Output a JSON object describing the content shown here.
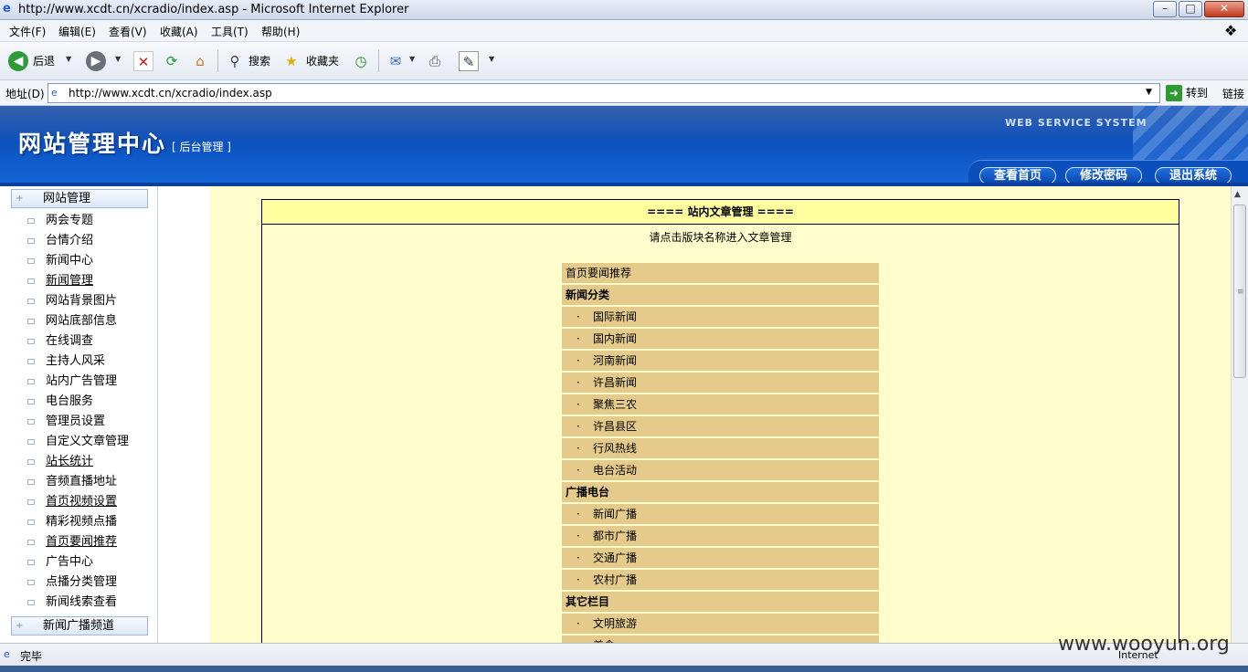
{
  "window": {
    "title": "http://www.xcdt.cn/xcradio/index.asp - Microsoft Internet Explorer",
    "min": "–",
    "max": "□",
    "close": "✕"
  },
  "menu": [
    "文件(F)",
    "编辑(E)",
    "查看(V)",
    "收藏(A)",
    "工具(T)",
    "帮助(H)"
  ],
  "toolbar": {
    "back": "后退",
    "search": "搜索",
    "favorites": "收藏夹"
  },
  "address": {
    "label": "地址(D)",
    "url": "http://www.xcdt.cn/xcradio/index.asp",
    "go": "转到",
    "links": "链接"
  },
  "banner": {
    "title": "网站管理中心",
    "subtitle": "[ 后台管理 ]",
    "tagline": "WEB SERVICE SYSTEM",
    "nav": [
      "查看首页",
      "修改密码",
      "退出系统"
    ]
  },
  "sidebar": {
    "group1": "网站管理",
    "items": [
      "两会专题",
      "台情介绍",
      "新闻中心",
      "新闻管理",
      "网站背景图片",
      "网站底部信息",
      "在线调查",
      "主持人风采",
      "站内广告管理",
      "电台服务",
      "管理员设置",
      "自定义文章管理",
      "站长统计",
      "音频直播地址",
      "首页视频设置",
      "精彩视频点播",
      "首页要闻推荐",
      "广告中心",
      "点播分类管理",
      "新闻线索查看"
    ],
    "group2": "新闻广播频道"
  },
  "panel": {
    "heading": "====  站内文章管理  ====",
    "tip": "请点击版块名称进入文章管理",
    "rows": [
      {
        "label": "首页要闻推荐",
        "kind": "top"
      },
      {
        "label": "新闻分类",
        "kind": "bold"
      },
      {
        "label": "国际新闻",
        "kind": "sub"
      },
      {
        "label": "国内新闻",
        "kind": "sub"
      },
      {
        "label": "河南新闻",
        "kind": "sub"
      },
      {
        "label": "许昌新闻",
        "kind": "sub"
      },
      {
        "label": "聚焦三农",
        "kind": "sub"
      },
      {
        "label": "许昌县区",
        "kind": "sub"
      },
      {
        "label": "行风热线",
        "kind": "sub"
      },
      {
        "label": "电台活动",
        "kind": "sub"
      },
      {
        "label": "广播电台",
        "kind": "bold"
      },
      {
        "label": "新闻广播",
        "kind": "sub"
      },
      {
        "label": "都市广播",
        "kind": "sub"
      },
      {
        "label": "交通广播",
        "kind": "sub"
      },
      {
        "label": "农村广播",
        "kind": "sub"
      },
      {
        "label": "其它栏目",
        "kind": "bold"
      },
      {
        "label": "文明旅游",
        "kind": "sub"
      },
      {
        "label": "美食",
        "kind": "sub"
      }
    ],
    "bullet": "·"
  },
  "status": {
    "text": "完毕",
    "zone": "Internet"
  },
  "watermark": "www.wooyun.org"
}
